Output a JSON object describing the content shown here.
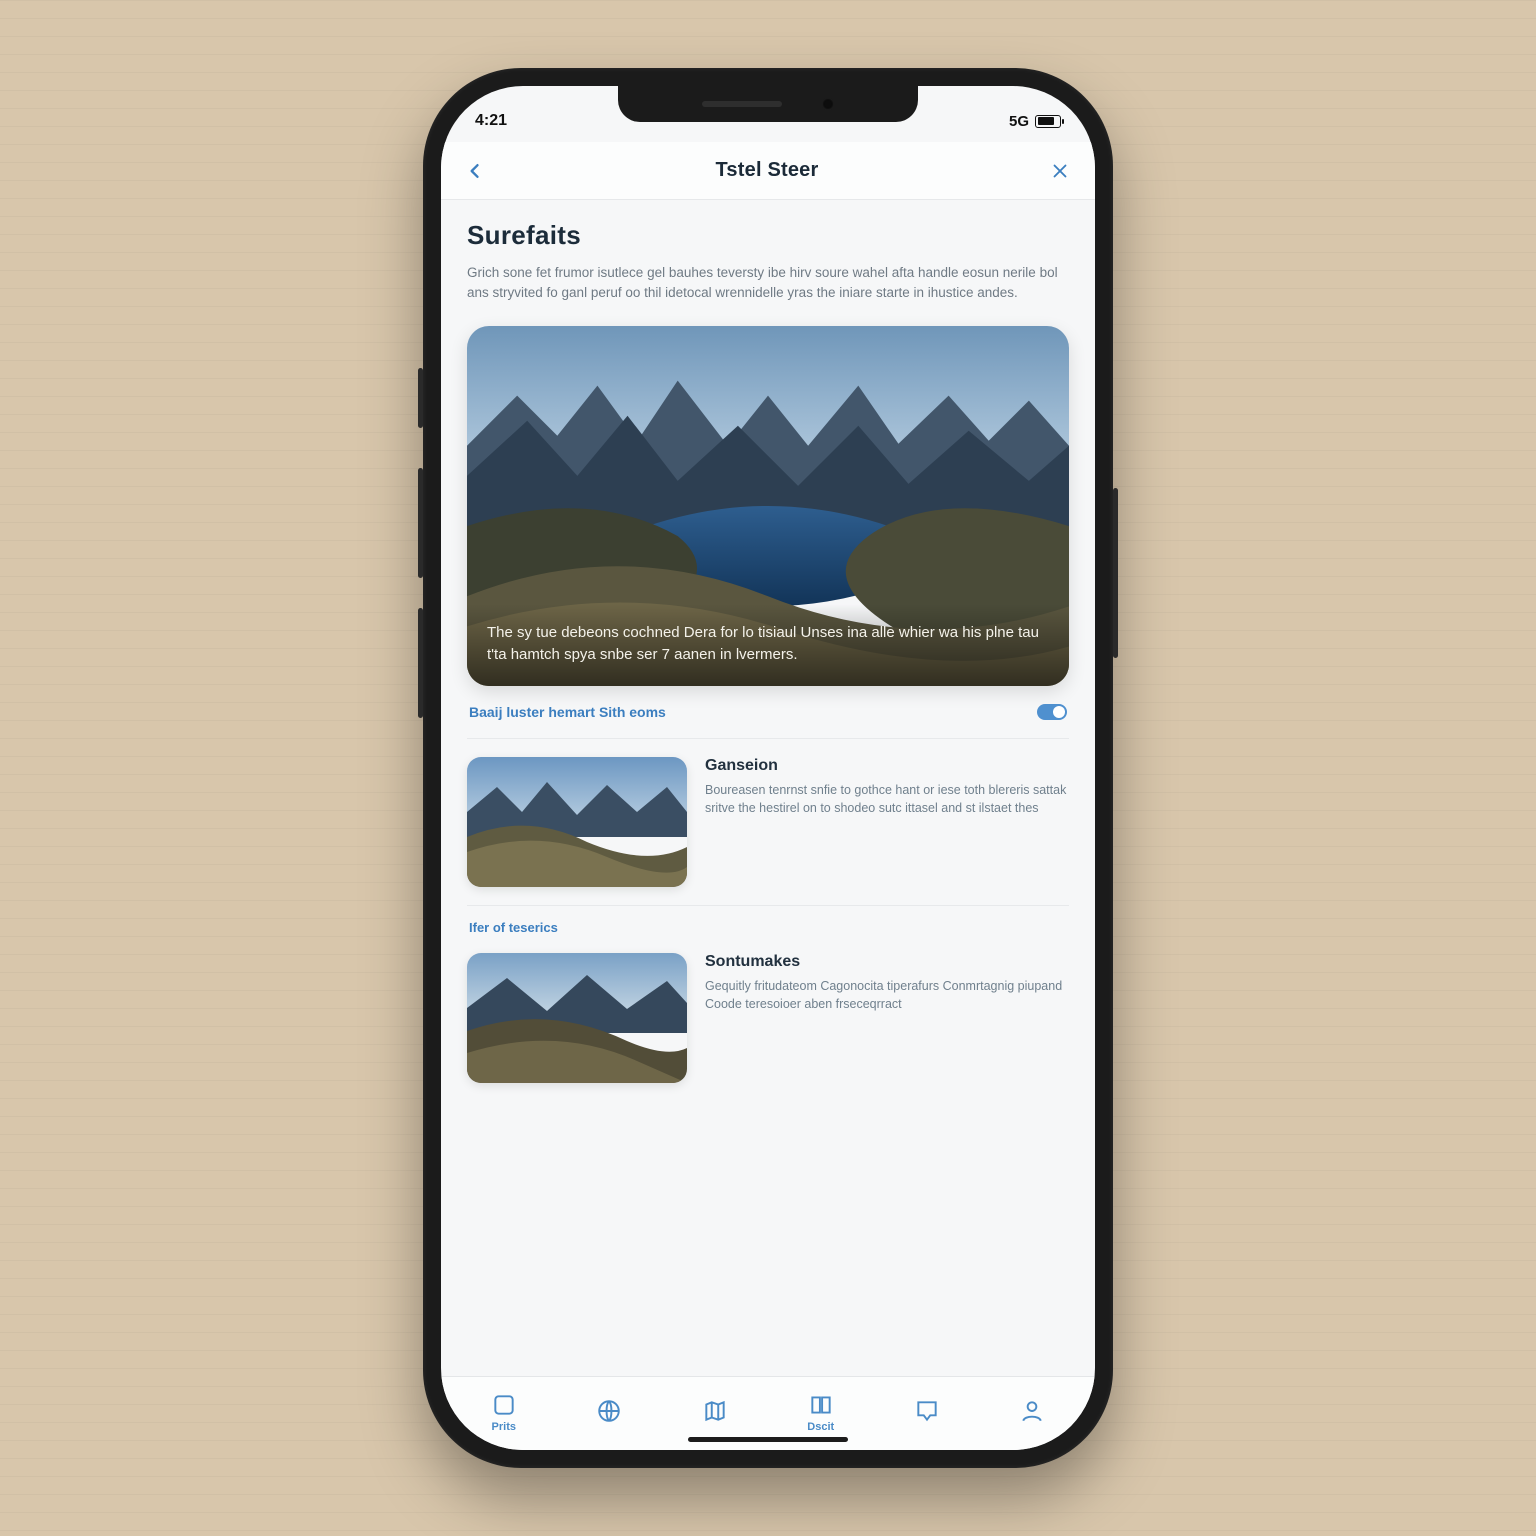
{
  "status": {
    "time": "4:21",
    "carrier": "5G"
  },
  "nav": {
    "title": "Tstel Steer"
  },
  "section": {
    "heading": "Surefaits",
    "intro": "Grich sone fet frumor isutlece gel bauhes teversty ibe hirv soure wahel afta handle eosun nerile bol ans stryvited fo ganl peruf oo thil idetocal wrennidelle yras the iniare starte in ihustice andes."
  },
  "hero": {
    "caption": "The sy tue debeons cochned Dera for lo tisiaul Unses ina alle whier wa his plne tau t'tа hamtch spya snbe ser 7 aanen in lvermers."
  },
  "link1": {
    "label": "Baaij luster hemart Sith eoms"
  },
  "items": [
    {
      "title": "Ganseion",
      "desc": "Boureasen tenrnst snfie to gothce hant or iese toth blereris sattak sritve the hestirel on to shodeo sutc ittasel and st ilstaet thes"
    },
    {
      "title": "Sontumakes",
      "desc": "Gequitly fritudateom Cagonocita tiperafurs Conmrtagnig piupand Coode teresoioer aben frseceqrract"
    }
  ],
  "sublink": {
    "label": "Ifer of teserics"
  },
  "tabs": [
    {
      "label": "Prits"
    },
    {
      "label": ""
    },
    {
      "label": ""
    },
    {
      "label": "Dscit"
    },
    {
      "label": ""
    },
    {
      "label": ""
    }
  ]
}
